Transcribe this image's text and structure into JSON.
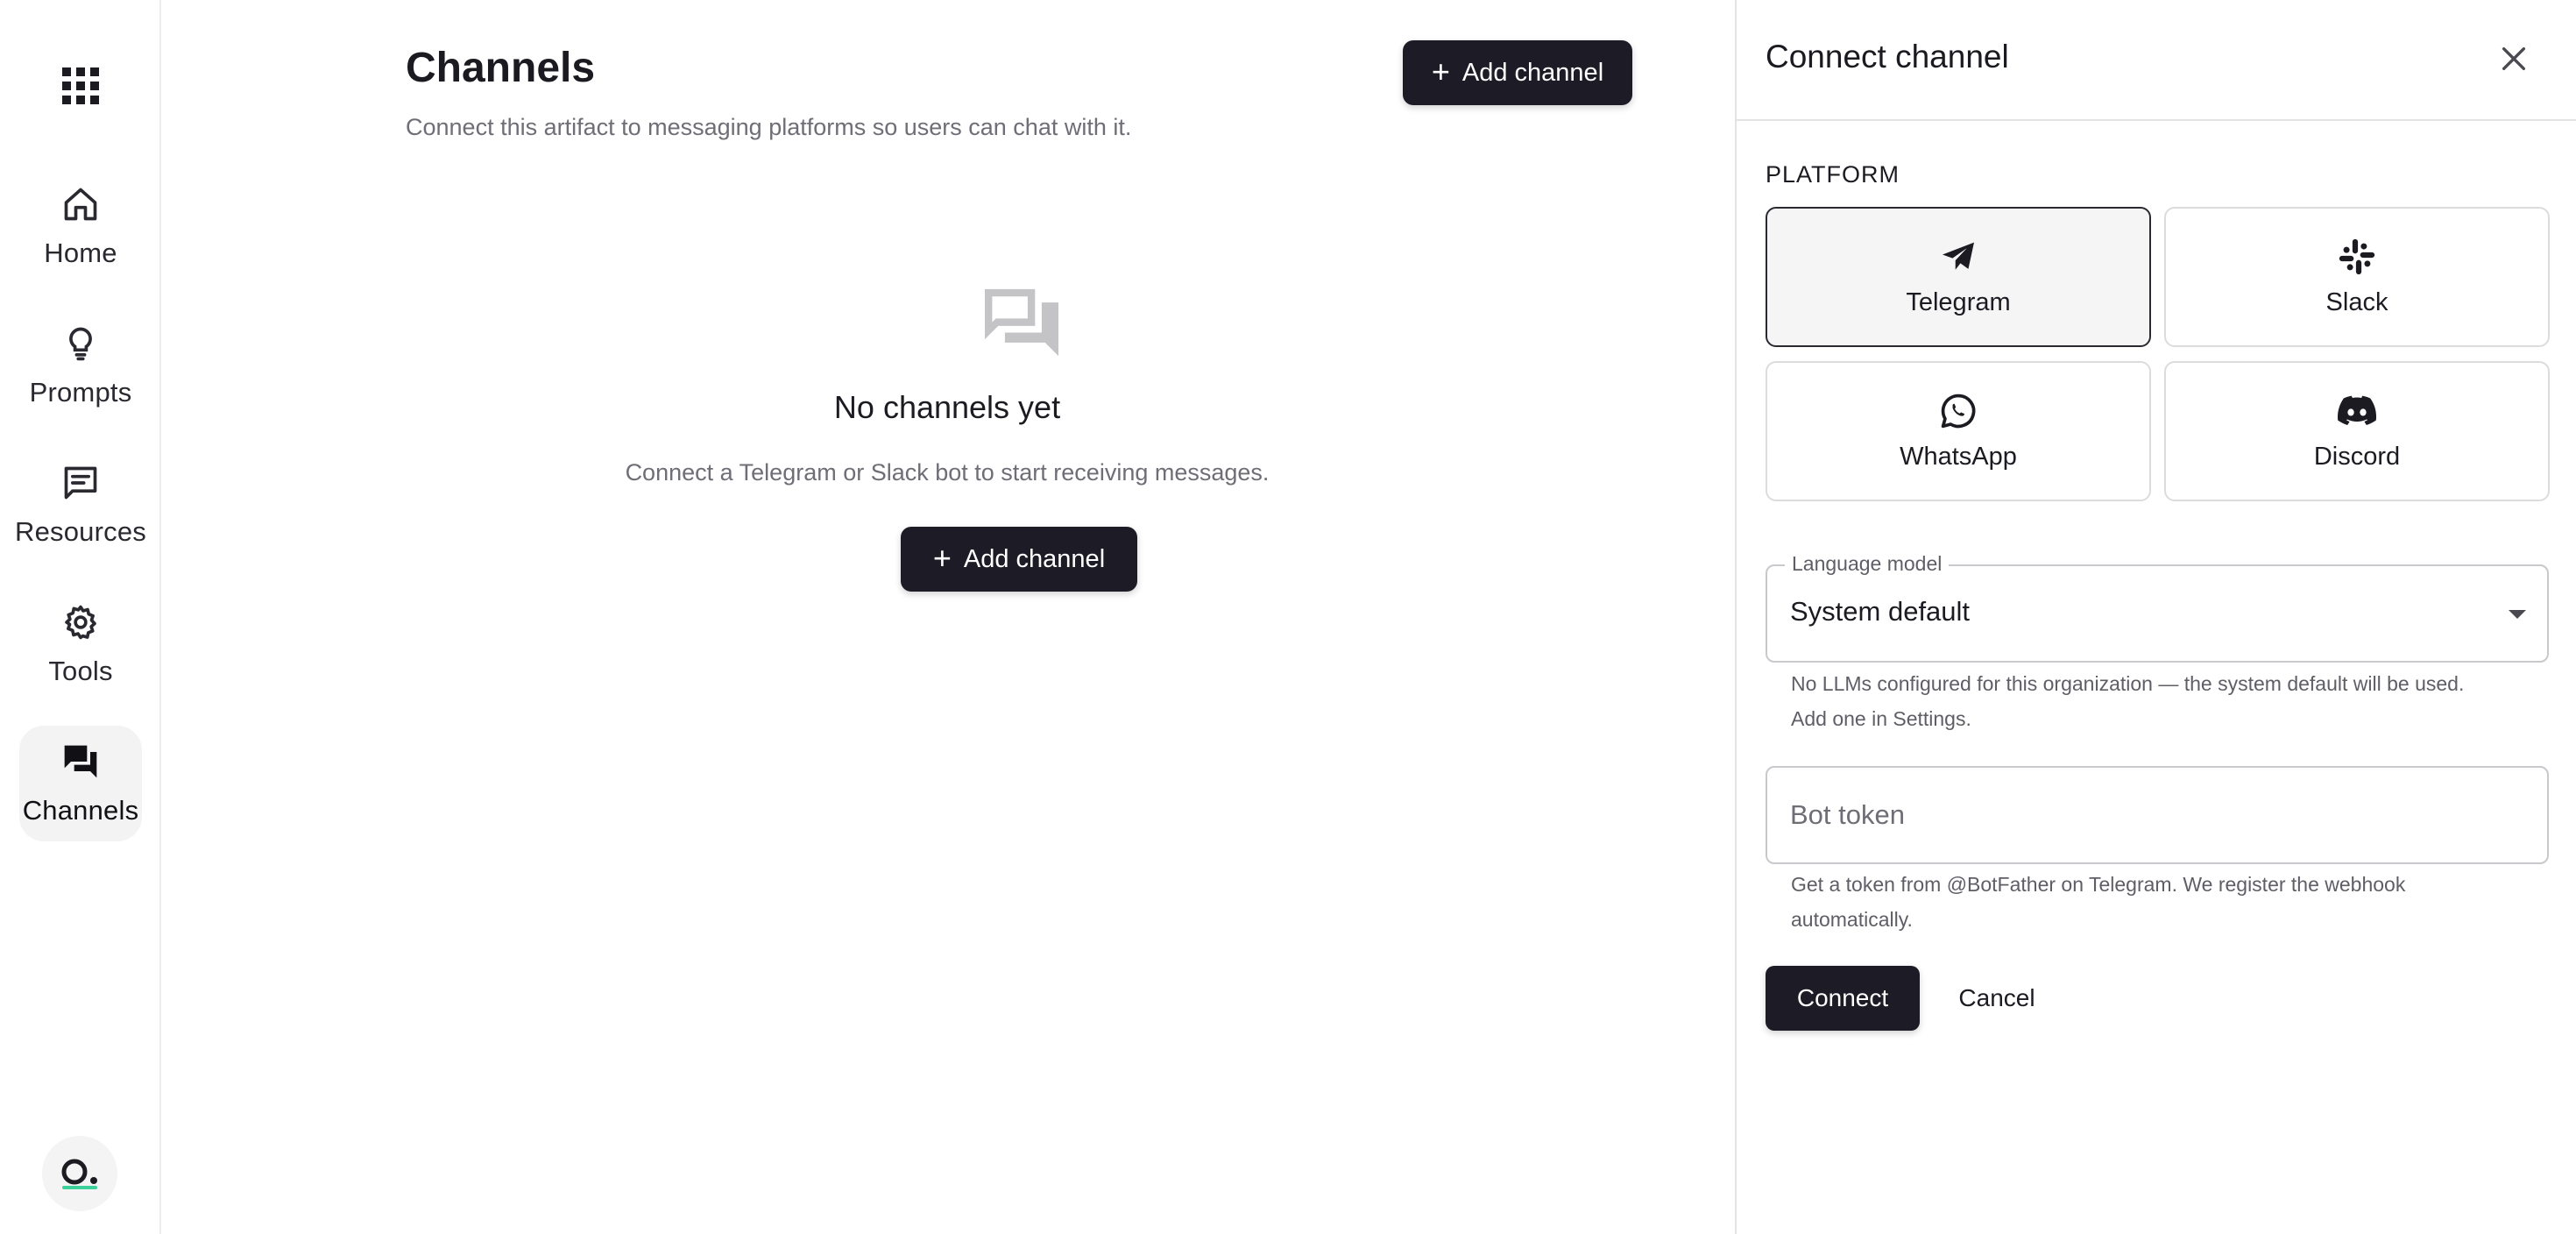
{
  "rail": {
    "apps_icon": "grid-icon",
    "items": [
      {
        "label": "Home",
        "icon": "home-icon"
      },
      {
        "label": "Prompts",
        "icon": "lightbulb-icon"
      },
      {
        "label": "Resources",
        "icon": "message-square-icon"
      },
      {
        "label": "Tools",
        "icon": "gear-icon"
      },
      {
        "label": "Channels",
        "icon": "forum-icon",
        "active": true
      }
    ]
  },
  "main": {
    "title": "Channels",
    "subtitle": "Connect this artifact to messaging platforms so users can chat with it.",
    "add_channel_label": "Add channel",
    "empty": {
      "title": "No channels yet",
      "subtitle": "Connect a Telegram or Slack bot to start receiving messages.",
      "button_label": "Add channel"
    }
  },
  "drawer": {
    "title": "Connect channel",
    "platform_label": "PLATFORM",
    "platforms": [
      {
        "label": "Telegram",
        "icon": "telegram-icon",
        "selected": true
      },
      {
        "label": "Slack",
        "icon": "slack-icon",
        "selected": false
      },
      {
        "label": "WhatsApp",
        "icon": "whatsapp-icon",
        "selected": false
      },
      {
        "label": "Discord",
        "icon": "discord-icon",
        "selected": false
      }
    ],
    "language_model": {
      "legend": "Language model",
      "value": "System default",
      "helper_line1": "No LLMs configured for this organization — the system default will be used.",
      "helper_line2": "Add one in Settings."
    },
    "bot_token": {
      "placeholder": "Bot token",
      "value": "",
      "helper_line1": "Get a token from @BotFather on Telegram. We register the webhook",
      "helper_line2": "automatically."
    },
    "connect_label": "Connect",
    "cancel_label": "Cancel"
  },
  "colors": {
    "primary_button": "#1d1b26",
    "text": "#1c1b22",
    "muted_text": "#6f6e76",
    "border": "#dcdcdf",
    "active_bg": "#f3f3f4"
  }
}
